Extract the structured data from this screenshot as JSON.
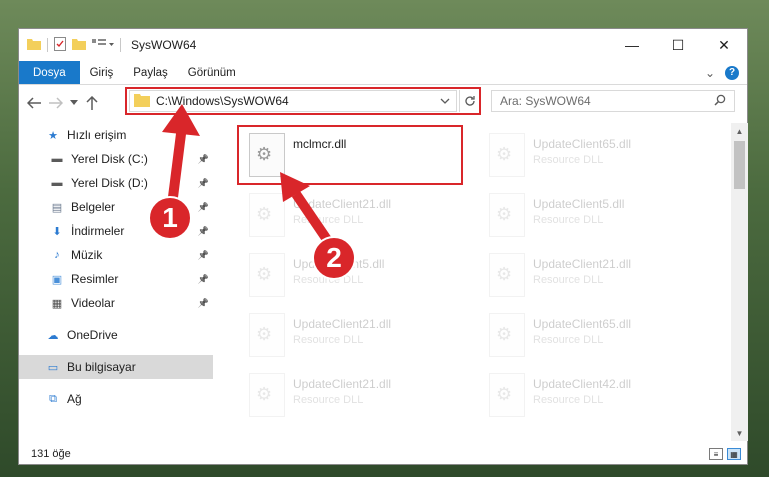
{
  "window": {
    "title": "SysWOW64",
    "minimize_glyph": "—",
    "maximize_glyph": "☐",
    "close_glyph": "✕"
  },
  "ribbon": {
    "tabs": [
      "Dosya",
      "Giriş",
      "Paylaş",
      "Görünüm"
    ],
    "collapse_glyph": "⌄",
    "help_glyph": "?"
  },
  "address": {
    "path": "C:\\Windows\\SysWOW64",
    "search_placeholder": "Ara: SysWOW64"
  },
  "nav": {
    "items": [
      {
        "label": "Hızlı erişim",
        "icon": "star-icon",
        "pinned": false
      },
      {
        "label": "Yerel Disk (C:)",
        "icon": "drive-icon",
        "pinned": true
      },
      {
        "label": "Yerel Disk (D:)",
        "icon": "drive-icon",
        "pinned": true
      },
      {
        "label": "Belgeler",
        "icon": "documents-icon",
        "pinned": true
      },
      {
        "label": "İndirmeler",
        "icon": "downloads-icon",
        "pinned": true
      },
      {
        "label": "Müzik",
        "icon": "music-icon",
        "pinned": true
      },
      {
        "label": "Resimler",
        "icon": "pictures-icon",
        "pinned": true
      },
      {
        "label": "Videolar",
        "icon": "videos-icon",
        "pinned": true
      },
      {
        "label": "OneDrive",
        "icon": "cloud-icon",
        "pinned": false
      },
      {
        "label": "Bu bilgisayar",
        "icon": "computer-icon",
        "pinned": false,
        "selected": true
      },
      {
        "label": "Ağ",
        "icon": "network-icon",
        "pinned": false
      }
    ]
  },
  "files": [
    {
      "name": "mclmcr.dll",
      "type": "",
      "faded": false
    },
    {
      "name": "UpdateClient65.dll",
      "type": "Resource DLL",
      "faded": true
    },
    {
      "name": "UpdateClient21.dll",
      "type": "Resource DLL",
      "faded": true
    },
    {
      "name": "UpdateClient5.dll",
      "type": "Resource DLL",
      "faded": true
    },
    {
      "name": "UpdateClient5.dll",
      "type": "Resource DLL",
      "faded": true
    },
    {
      "name": "UpdateClient21.dll",
      "type": "Resource DLL",
      "faded": true
    },
    {
      "name": "UpdateClient21.dll",
      "type": "Resource DLL",
      "faded": true
    },
    {
      "name": "UpdateClient65.dll",
      "type": "Resource DLL",
      "faded": true
    },
    {
      "name": "UpdateClient21.dll",
      "type": "Resource DLL",
      "faded": true
    },
    {
      "name": "UpdateClient42.dll",
      "type": "Resource DLL",
      "faded": true
    }
  ],
  "status": {
    "count": "131 öğe"
  },
  "annotations": {
    "badge1": "1",
    "badge2": "2",
    "color": "#d9262a"
  }
}
